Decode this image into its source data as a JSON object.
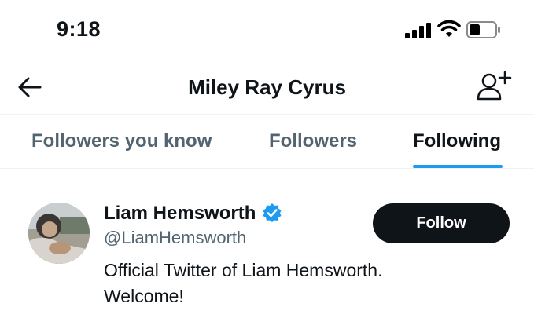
{
  "status_bar": {
    "time": "9:18"
  },
  "header": {
    "title": "Miley Ray Cyrus"
  },
  "tabs": [
    {
      "label": "Followers you know",
      "active": false
    },
    {
      "label": "Followers",
      "active": false
    },
    {
      "label": "Following",
      "active": true
    }
  ],
  "user": {
    "name": "Liam Hemsworth",
    "handle": "@LiamHemsworth",
    "bio": "Official Twitter of Liam Hemsworth. Welcome!",
    "verified": true,
    "follow_label": "Follow"
  },
  "colors": {
    "accent": "#1d9bf0",
    "text": "#0f1419",
    "secondary": "#536471",
    "button": "#0f1419"
  },
  "icons": [
    "cellular-signal-icon",
    "wifi-icon",
    "battery-icon",
    "back-arrow-icon",
    "add-user-icon",
    "verified-badge-icon",
    "avatar"
  ]
}
